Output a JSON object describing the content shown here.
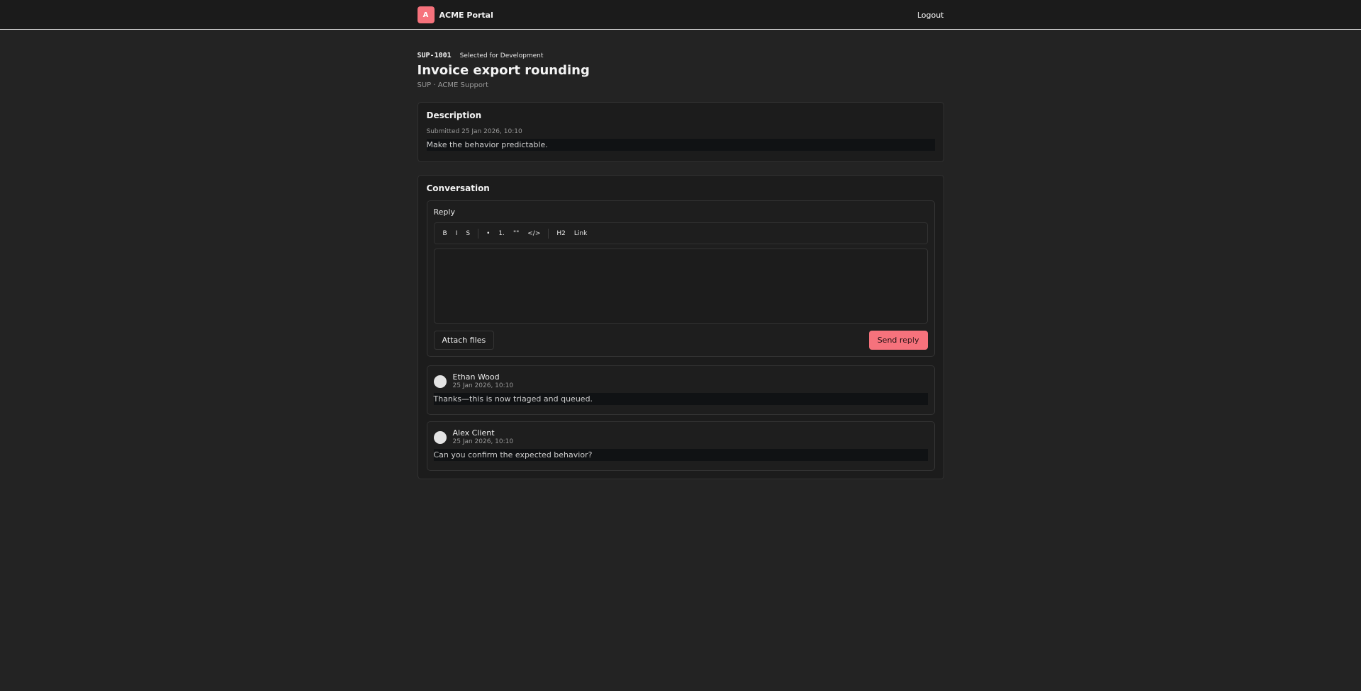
{
  "header": {
    "logo_letter": "A",
    "brand": "ACME Portal",
    "logout": "Logout"
  },
  "issue": {
    "key": "SUP-1001",
    "status": "Selected for Development",
    "title": "Invoice export rounding",
    "subtitle": "SUP · ACME Support"
  },
  "description": {
    "heading": "Description",
    "submitted": "Submitted 25 Jan 2026, 10:10",
    "body": "Make the behavior predictable."
  },
  "conversation": {
    "heading": "Conversation",
    "reply_label": "Reply",
    "toolbar": {
      "bold": "B",
      "italic": "I",
      "strike": "S",
      "bullet": "•",
      "ordered": "1.",
      "quote": "\"\"",
      "code": "</>",
      "h2": "H2",
      "link": "Link"
    },
    "attach": "Attach files",
    "send": "Send reply",
    "comments": [
      {
        "author": "Ethan Wood",
        "time": "25 Jan 2026, 10:10",
        "body": "Thanks—this is now triaged and queued."
      },
      {
        "author": "Alex Client",
        "time": "25 Jan 2026, 10:10",
        "body": "Can you confirm the expected behavior?"
      }
    ]
  },
  "colors": {
    "accent": "#f6727c",
    "background": "#232323",
    "card": "#1c1c1c"
  }
}
